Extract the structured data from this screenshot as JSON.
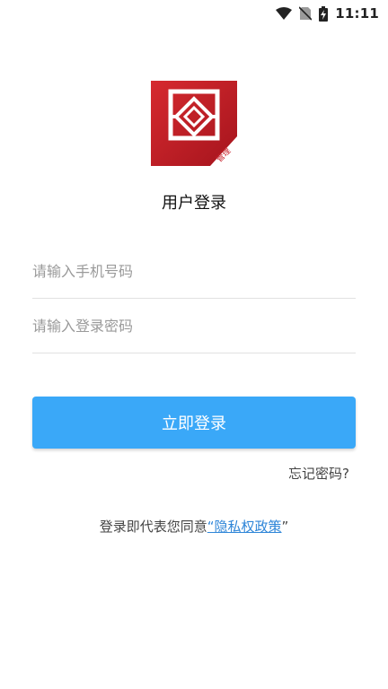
{
  "status_bar": {
    "time": "11:11",
    "icons": [
      "wifi-icon",
      "no-sim-icon",
      "battery-charging-icon"
    ]
  },
  "app": {
    "logo_icon": "app-logo-icon",
    "logo_badge_text": "管理",
    "title": "用户登录"
  },
  "form": {
    "phone_placeholder": "请输入手机号码",
    "password_placeholder": "请输入登录密码",
    "submit_label": "立即登录",
    "forgot_label": "忘记密码?"
  },
  "agreement": {
    "prefix": "登录即代表您同意",
    "open_quote": "“",
    "policy_label": "隐私权政策",
    "close_quote": "”"
  },
  "colors": {
    "primary": "#3aa8f8",
    "logo_red": "#c8202a",
    "link": "#2f86d8"
  }
}
